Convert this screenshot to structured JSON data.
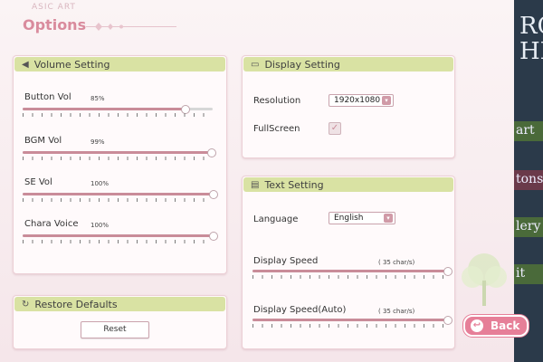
{
  "header": {
    "logo_text": "ASIC ART",
    "title": "Options"
  },
  "volume": {
    "heading": "Volume Setting",
    "sliders": [
      {
        "label": "Button Vol",
        "percent_text": "85%",
        "value": 0.85
      },
      {
        "label": "BGM Vol",
        "percent_text": "99%",
        "value": 0.99
      },
      {
        "label": "SE Vol",
        "percent_text": "100%",
        "value": 1.0
      },
      {
        "label": "Chara Voice",
        "percent_text": "100%",
        "value": 1.0
      }
    ]
  },
  "restore": {
    "heading": "Restore Defaults",
    "reset_label": "Reset"
  },
  "display": {
    "heading": "Display Setting",
    "resolution_label": "Resolution",
    "resolution_value": "1920x1080",
    "fullscreen_label": "FullScreen",
    "fullscreen_checked": true
  },
  "text": {
    "heading": "Text Setting",
    "language_label": "Language",
    "language_value": "English",
    "speed_label": "Display Speed",
    "speed_value_text": "( 35  char/s)",
    "speed_value": 1.0,
    "auto_label": "Display Speed(Auto)",
    "auto_value_text": "( 35  char/s)",
    "auto_value": 1.0
  },
  "back_label": "Back",
  "background_menu": {
    "strip_letters": [
      "RO",
      "HI"
    ],
    "items": [
      "art",
      "tons",
      "lery",
      "it"
    ]
  },
  "colors": {
    "accent": "#e67f98",
    "panel_header": "#d9e2a3",
    "slider_fill": "#c98c99"
  }
}
